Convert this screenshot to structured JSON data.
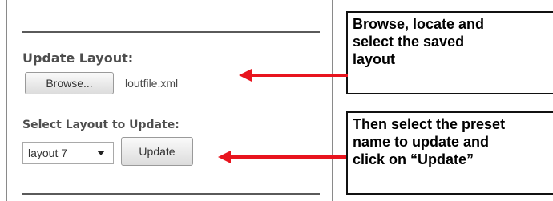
{
  "update_layout": {
    "title": "Update Layout:",
    "browse_label": "Browse...",
    "filename": "loutfile.xml"
  },
  "select_layout": {
    "title": "Select Layout to Update:",
    "selected": "layout 7",
    "update_label": "Update"
  },
  "callouts": {
    "first": {
      "line1": "Browse, locate and",
      "line2": "select the saved",
      "line3": "layout"
    },
    "second": {
      "line1": "Then select the preset",
      "line2": "name to update and",
      "line3": "click on “Update”"
    }
  },
  "colors": {
    "arrow": "#e8141e",
    "callout_border": "#111111",
    "panel_text": "#4d4d4d"
  },
  "icons": {
    "dropdown": "chevron-down-icon",
    "pointer": "arrow-left-icon"
  }
}
